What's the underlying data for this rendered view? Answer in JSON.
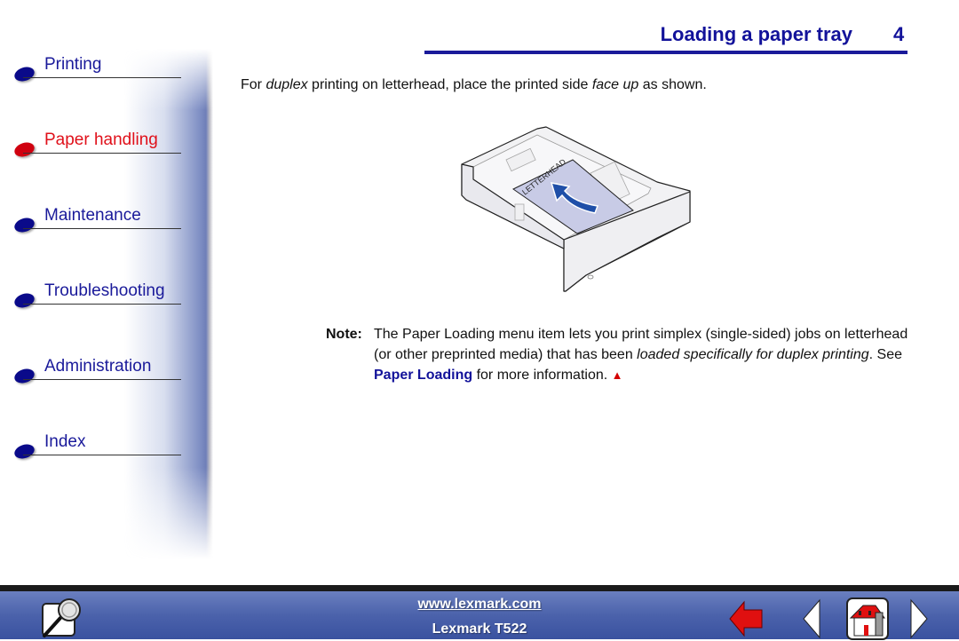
{
  "sidebar": {
    "items": [
      {
        "label": "Printing",
        "active": false,
        "dot_color": "#0a0a8a"
      },
      {
        "label": "Paper handling",
        "active": true,
        "dot_color": "#d00010"
      },
      {
        "label": "Maintenance",
        "active": false,
        "dot_color": "#0a0a8a"
      },
      {
        "label": "Troubleshooting",
        "active": false,
        "dot_color": "#0a0a8a"
      },
      {
        "label": "Administration",
        "active": false,
        "dot_color": "#0a0a8a"
      },
      {
        "label": "Index",
        "active": false,
        "dot_color": "#0a0a8a"
      }
    ]
  },
  "header": {
    "title": "Loading a paper tray",
    "page_number": "4"
  },
  "content": {
    "intro": {
      "t1": "For ",
      "t2_italic": "duplex",
      "t3": " printing on letterhead, place the printed side ",
      "t4_italic": "face up",
      "t5": " as shown."
    },
    "illustration": {
      "paper_label": "LETTERHEAD",
      "description": "paper tray with letterhead sheet and feed arrow"
    },
    "note": {
      "label": "Note:",
      "t1": "The Paper Loading menu item lets you print simplex (single-sided) jobs on letterhead (or other preprinted media) that has been ",
      "t2_italic": "loaded specifically for duplex printing",
      "t3": ". See ",
      "link": "Paper Loading",
      "t4": " for more information. ",
      "end_mark": "▲"
    }
  },
  "footer": {
    "url": "www.lexmark.com",
    "model": "Lexmark T522",
    "buttons": [
      "search",
      "back",
      "previous-page",
      "home",
      "next-page"
    ]
  },
  "colors": {
    "nav_blue": "#1a1a9a",
    "nav_active": "#e0101a",
    "footer_blue": "#4b62ab",
    "accent_red": "#d40000"
  }
}
